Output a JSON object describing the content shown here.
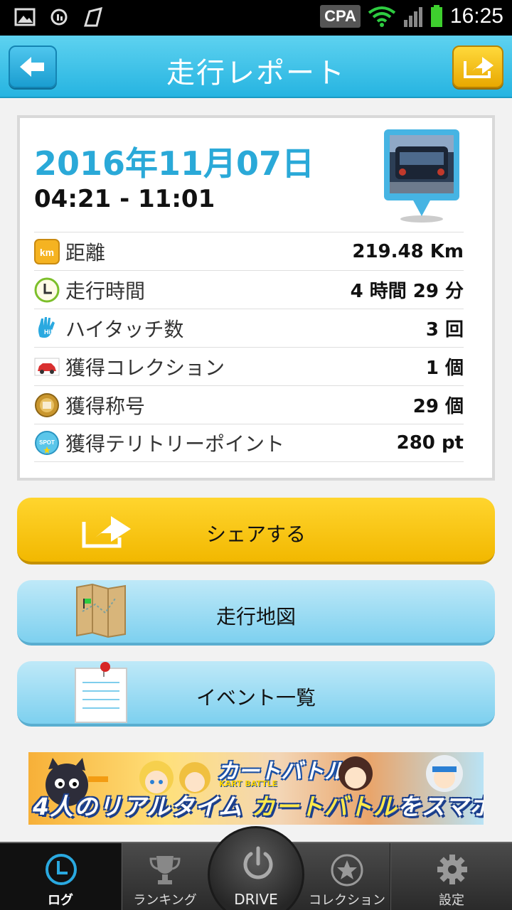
{
  "status_bar": {
    "carrier": "CPA",
    "time": "16:25"
  },
  "header": {
    "title": "走行レポート"
  },
  "report": {
    "date": "2016年11月07日",
    "time_range": "04:21 - 11:01",
    "rows": [
      {
        "icon": "km-icon",
        "label": "距離",
        "value": "219.48 Km"
      },
      {
        "icon": "clock-icon",
        "label": "走行時間",
        "value": "4 時間 29 分"
      },
      {
        "icon": "hi-five-icon",
        "label": "ハイタッチ数",
        "value": "3 回"
      },
      {
        "icon": "car-icon",
        "label": "獲得コレクション",
        "value": "1 個"
      },
      {
        "icon": "medal-icon",
        "label": "獲得称号",
        "value": "29 個"
      },
      {
        "icon": "spot-icon",
        "label": "獲得テリトリーポイント",
        "value": "280 pt"
      }
    ],
    "km_badge": "km",
    "spot_badge": "SPOT"
  },
  "actions": {
    "share": "シェアする",
    "map": "走行地図",
    "events": "イベント一覧"
  },
  "banner": {
    "title": "カートバトル",
    "subtitle": "KART BATTLE",
    "caption_part1": "4人のリアルタイム ",
    "caption_part2": "カートバトル",
    "caption_part3": "をスマホで!"
  },
  "bottom_nav": {
    "log": "ログ",
    "ranking": "ランキング",
    "drive": "DRIVE",
    "collection": "コレクション",
    "settings": "設定"
  },
  "colors": {
    "accent": "#2aa9d8",
    "share": "#f2b800",
    "header": "#26b4e1"
  }
}
